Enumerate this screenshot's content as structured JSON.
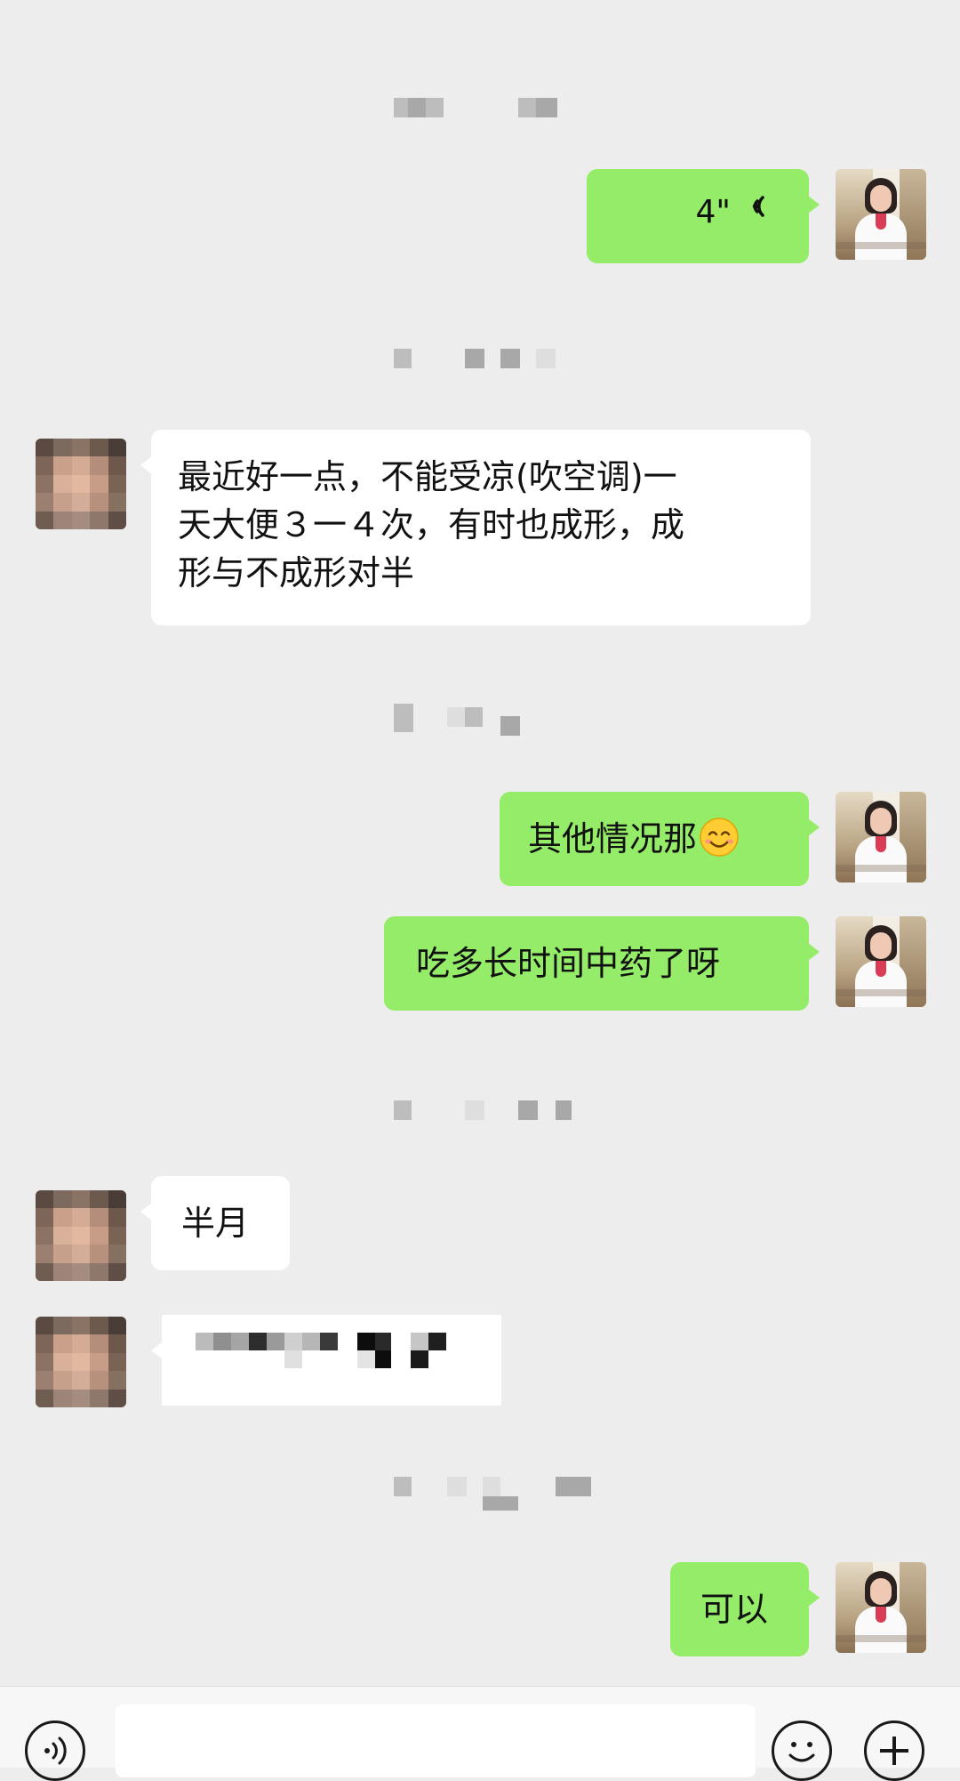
{
  "messages": [
    {
      "side": "me",
      "type": "voice",
      "duration": "4\""
    },
    {
      "side": "them",
      "type": "text",
      "text": "最近好一点，不能受凉(吹空调)一\n天大便３一４次，有时也成形，成\n形与不成形对半"
    },
    {
      "side": "me",
      "type": "text",
      "text": "其他情况那"
    },
    {
      "side": "me",
      "type": "text",
      "text": "吃多长时间中药了呀"
    },
    {
      "side": "them",
      "type": "text",
      "text": "半月"
    },
    {
      "side": "them",
      "type": "text",
      "text": ""
    },
    {
      "side": "me",
      "type": "text",
      "text": "可以"
    }
  ],
  "icons": {
    "voice_message": "voice-wave-icon",
    "emoji": "smiling-face-emoji",
    "input_voice": "voice-input-icon",
    "input_emoji": "emoji-icon",
    "input_more": "plus-icon"
  },
  "colors": {
    "background": "#ededed",
    "sent_bubble": "#95ec69",
    "received_bubble": "#ffffff",
    "text": "#111111"
  }
}
